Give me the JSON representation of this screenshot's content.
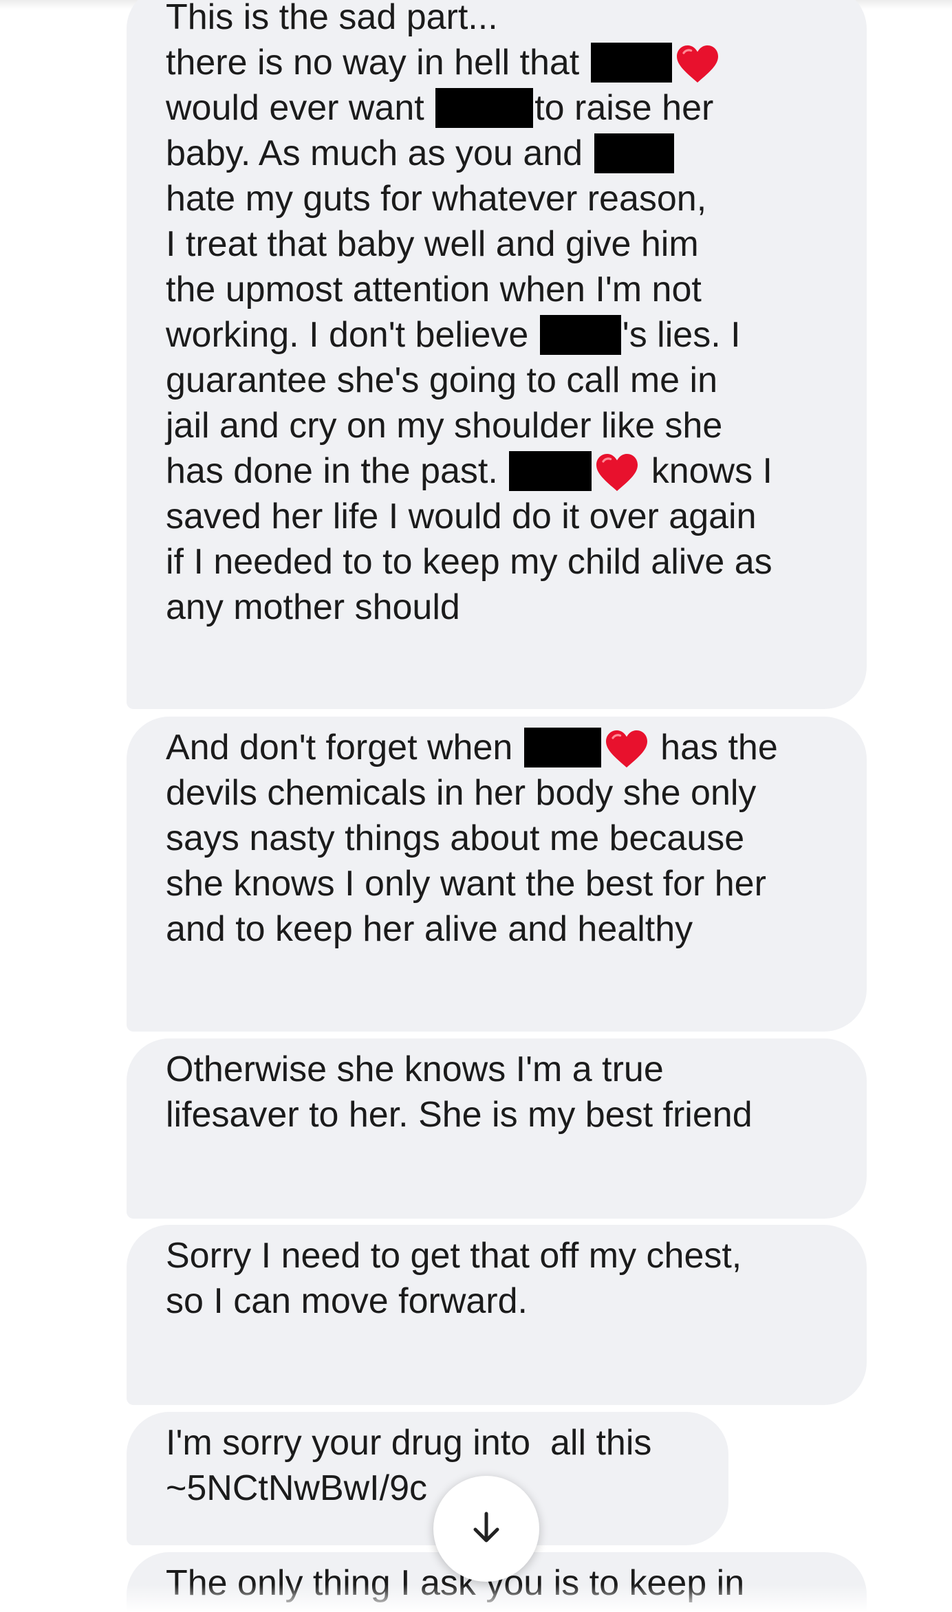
{
  "messages": [
    {
      "lines": [
        [
          "This is the sad part..."
        ],
        [
          "there is no way in hell that ",
          "[redacted]",
          "[heart]"
        ],
        [
          "would ever want ",
          "[redacted]",
          "to raise her"
        ],
        [
          "baby. As much as you and ",
          "[redacted]"
        ],
        [
          "hate my guts for whatever reason,"
        ],
        [
          "I treat that baby well and give him"
        ],
        [
          "the upmost attention when I'm not"
        ],
        [
          "working. I don't believe ",
          "[redacted]",
          "'s lies. I"
        ],
        [
          "guarantee she's going to call me in"
        ],
        [
          "jail and cry on my shoulder like she"
        ],
        [
          "has done in the past. ",
          "[redacted]",
          "[heart]",
          " knows I"
        ],
        [
          "saved her life I would do it over again"
        ],
        [
          "if I needed to to keep my child alive as"
        ],
        [
          "any mother should"
        ]
      ]
    },
    {
      "lines": [
        [
          "And don't forget when ",
          "[redacted]",
          "[heart]",
          " has the"
        ],
        [
          "devils chemicals in her body she only"
        ],
        [
          "says nasty things about me because"
        ],
        [
          "she knows I only want the best for her"
        ],
        [
          "and to keep her alive and healthy"
        ]
      ]
    },
    {
      "lines": [
        [
          "Otherwise she knows I'm a true"
        ],
        [
          "lifesaver to her. She is my best friend"
        ]
      ]
    },
    {
      "lines": [
        [
          "Sorry I need to get that off my chest,"
        ],
        [
          "so I can move forward."
        ]
      ]
    },
    {
      "lines": [
        [
          "I'm sorry your drug into  all this"
        ],
        [
          "~5NCtNwBwI/9c"
        ]
      ]
    },
    {
      "lines": [
        [
          "The only thing I ask you is to keep in"
        ]
      ]
    }
  ],
  "scroll_button": {
    "icon": "arrow-down-icon"
  },
  "colors": {
    "bubble": "#f0f1f4",
    "text": "#1b1b1b",
    "redaction": "#000000",
    "heart": "#e8112d"
  }
}
